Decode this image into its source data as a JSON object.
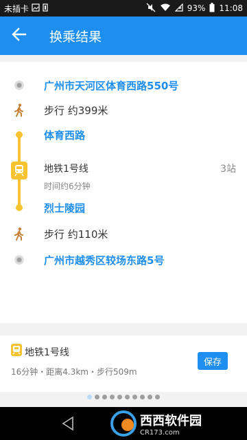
{
  "status_bar": {
    "sim": "未插卡",
    "battery": "93%",
    "time": "11:08"
  },
  "header": {
    "title": "换乘结果"
  },
  "route": {
    "origin": "广州市天河区体育西路550号",
    "walk_1": "步行 约399米",
    "board_station": "体育西路",
    "line_name": "地铁1号线",
    "stops": "3站",
    "duration": "时间约6分钟",
    "alight_station": "烈士陵园",
    "walk_2": "步行 约110米",
    "destination": "广州市越秀区较场东路5号"
  },
  "summary": {
    "line": "地铁1号线",
    "meta": "16分钟・距离4.3km・步行509m",
    "save_label": "保存"
  },
  "pager": {
    "total": 10,
    "active": 0
  },
  "watermark": {
    "brand": "西西软件园",
    "sub": "CR173.com"
  },
  "colors": {
    "accent": "#1e8ef0",
    "metro": "#f7c331"
  }
}
